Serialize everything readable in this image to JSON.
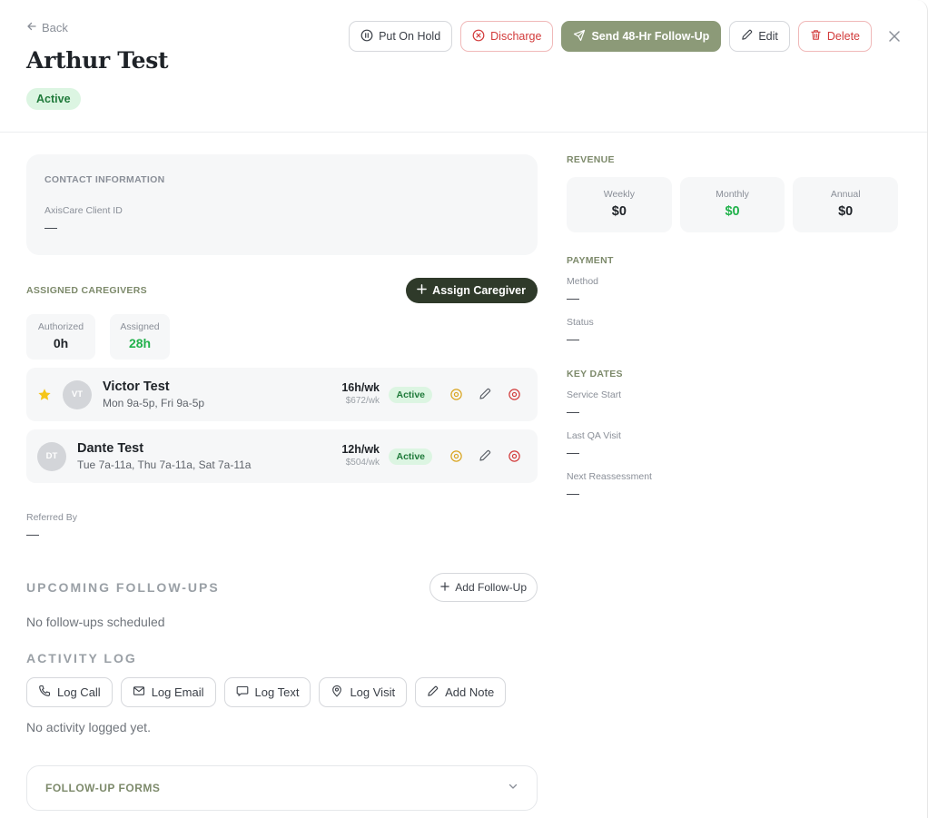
{
  "header": {
    "back_label": "Back",
    "title": "Arthur Test",
    "status": "Active"
  },
  "actions": {
    "hold": "Put On Hold",
    "discharge": "Discharge",
    "followup": "Send 48-Hr Follow-Up",
    "edit": "Edit",
    "delete": "Delete"
  },
  "contact": {
    "heading": "CONTACT INFORMATION",
    "client_id_label": "AxisCare Client ID",
    "client_id_value": "—"
  },
  "caregivers": {
    "heading": "ASSIGNED CAREGIVERS",
    "assign_label": "Assign Caregiver",
    "authorized_label": "Authorized",
    "authorized_value": "0h",
    "assigned_label": "Assigned",
    "assigned_value": "28h",
    "items": [
      {
        "initials": "VT",
        "name": "Victor Test",
        "schedule": "Mon 9a-5p, Fri 9a-5p",
        "hours": "16h/wk",
        "rate": "$672/wk",
        "status": "Active",
        "primary": true
      },
      {
        "initials": "DT",
        "name": "Dante Test",
        "schedule": "Tue 7a-11a, Thu 7a-11a, Sat 7a-11a",
        "hours": "12h/wk",
        "rate": "$504/wk",
        "status": "Active",
        "primary": false
      }
    ]
  },
  "referred": {
    "label": "Referred By",
    "value": "—"
  },
  "followups": {
    "heading": "UPCOMING FOLLOW-UPS",
    "add_label": "Add Follow-Up",
    "empty": "No follow-ups scheduled"
  },
  "activity": {
    "heading": "ACTIVITY LOG",
    "buttons": [
      "Log Call",
      "Log Email",
      "Log Text",
      "Log Visit",
      "Add Note"
    ],
    "empty": "No activity logged yet."
  },
  "forms": {
    "heading": "FOLLOW-UP FORMS"
  },
  "revenue": {
    "heading": "REVENUE",
    "weekly_label": "Weekly",
    "weekly_value": "$0",
    "monthly_label": "Monthly",
    "monthly_value": "$0",
    "annual_label": "Annual",
    "annual_value": "$0"
  },
  "payment": {
    "heading": "PAYMENT",
    "method_label": "Method",
    "method_value": "—",
    "status_label": "Status",
    "status_value": "—"
  },
  "key_dates": {
    "heading": "KEY DATES",
    "service_start_label": "Service Start",
    "service_start_value": "—",
    "last_qa_label": "Last QA Visit",
    "last_qa_value": "—",
    "next_reassessment_label": "Next Reassessment",
    "next_reassessment_value": "—"
  },
  "colors": {
    "olive": "#8c9a78",
    "dark_green": "#2f3a2a",
    "active_green": "#22b24c",
    "danger": "#d23b3b",
    "star": "#f5c518",
    "target_icon": "#d9a520"
  },
  "icons": {
    "back": "arrow-left-icon",
    "hold": "pause-circle-icon",
    "discharge": "x-circle-icon",
    "followup": "send-icon",
    "edit": "pencil-icon",
    "delete": "trash-icon",
    "close": "close-icon",
    "star": "star-icon",
    "target": "target-icon",
    "remove": "remove-circle-icon",
    "plus": "plus-icon",
    "phone": "phone-icon",
    "mail": "mail-icon",
    "message": "message-icon",
    "pin": "map-pin-icon",
    "chevron": "chevron-down-icon"
  }
}
